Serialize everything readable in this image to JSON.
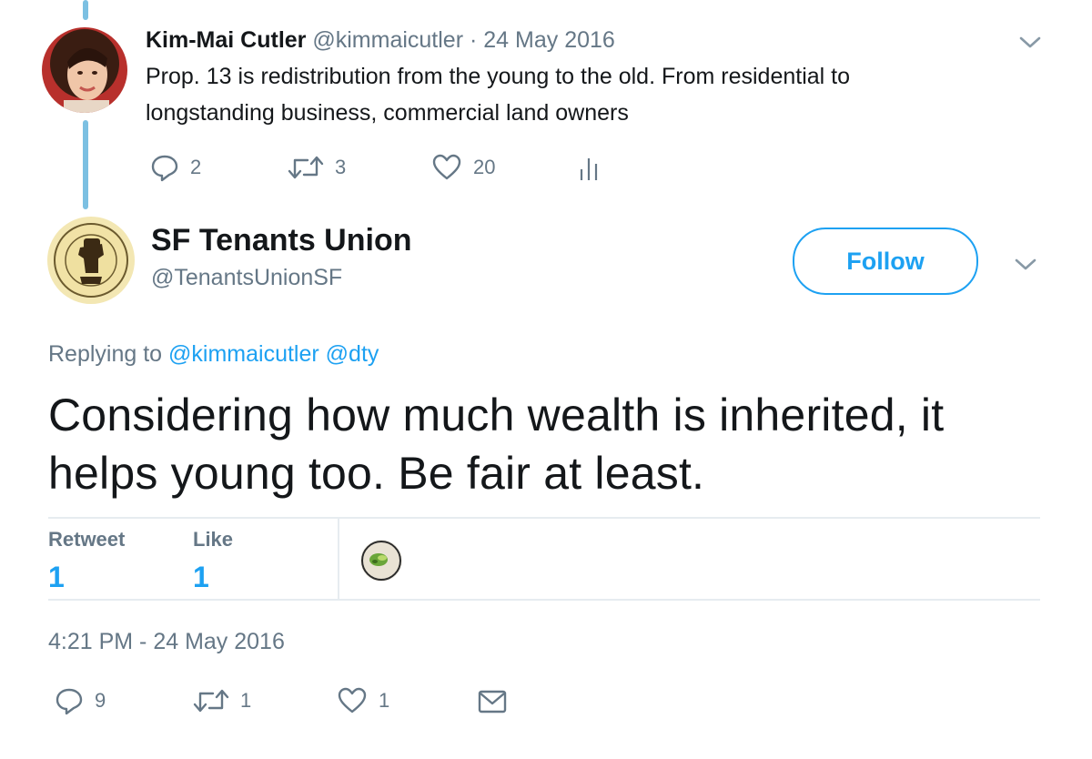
{
  "parent_tweet": {
    "author_name": "Kim-Mai Cutler",
    "author_handle": "@kimmaicutler",
    "separator": "·",
    "date": "24 May 2016",
    "text": "Prop. 13 is redistribution from the young to the old. From residential to longstanding business, commercial land owners",
    "actions": {
      "replies": "2",
      "retweets": "3",
      "likes": "20"
    }
  },
  "main_tweet": {
    "author_name": "SF Tenants Union",
    "author_handle": "@TenantsUnionSF",
    "follow_label": "Follow",
    "replying_prefix": "Replying to",
    "replying_mentions": [
      "@kimmaicutler",
      "@dty"
    ],
    "text": "Considering how much wealth is inherited, it helps young too. Be fair at least.",
    "stats": {
      "retweet_label": "Retweet",
      "retweet_count": "1",
      "like_label": "Like",
      "like_count": "1"
    },
    "timestamp": "4:21 PM - 24 May 2016",
    "actions": {
      "replies": "9",
      "retweets": "1",
      "likes": "1"
    }
  },
  "icons": {
    "reply": "reply-icon",
    "retweet": "retweet-icon",
    "like": "heart-icon",
    "analytics": "analytics-icon",
    "message": "envelope-icon",
    "more": "chevron-down-icon"
  },
  "colors": {
    "accent": "#1da1f2",
    "text": "#14171a",
    "muted": "#657786",
    "divider": "#e6ecf0",
    "thread_line": "#7cc0e2"
  }
}
